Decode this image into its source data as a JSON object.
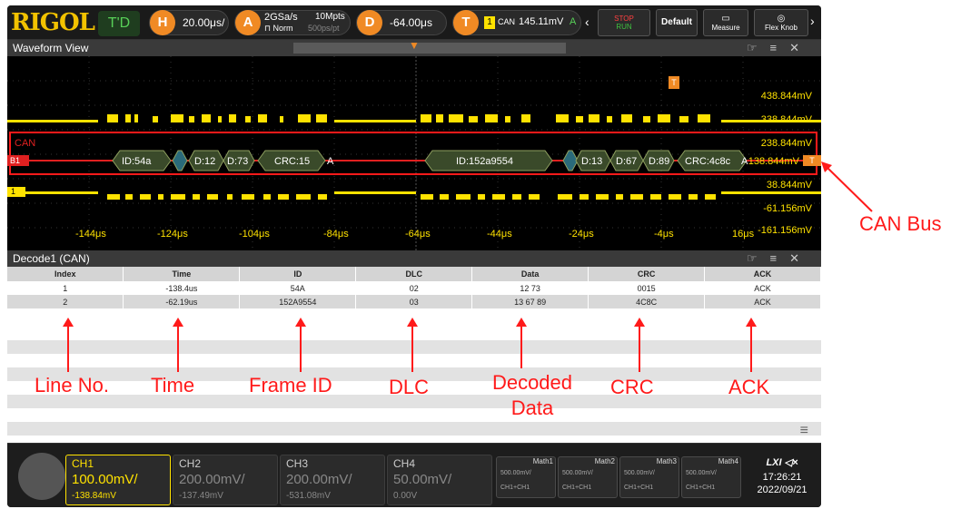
{
  "topbar": {
    "logo": "RIGOL",
    "trigger_mode": "T'D",
    "h_letter": "H",
    "timebase": "20.00μs/",
    "a_letter": "A",
    "sample_rate": "2GSa/s",
    "mem_depth": "10Mpts",
    "acq_mode": "Norm",
    "sample_interval": "500ps/pt",
    "d_letter": "D",
    "delay": "-64.00μs",
    "t_letter": "T",
    "trig_source_num": "1",
    "trig_type": "CAN",
    "trig_level": "145.11mV",
    "trig_sweep": "A",
    "stop": "STOP",
    "run": "RUN",
    "default": "Default",
    "measure": "Measure",
    "flex": "Flex Knob"
  },
  "waveform": {
    "title": "Waveform View",
    "bus_label": "CAN",
    "bus_marker": "B1",
    "ch1_marker": "1",
    "trig_marker": "T",
    "level_marker": "T",
    "decode": {
      "frame1": [
        "ID:54a",
        "D:12",
        "D:73",
        "CRC:15",
        "A"
      ],
      "frame2": [
        "ID:152a9554",
        "D:13",
        "D:67",
        "D:89",
        "CRC:4c8c",
        "A"
      ]
    },
    "voltage_labels": [
      "438.844mV",
      "338.844mV",
      "238.844mV",
      "138.844mV",
      "38.844mV",
      "-61.156mV",
      "-161.156mV"
    ],
    "time_labels": [
      "-144μs",
      "-124μs",
      "-104μs",
      "-84μs",
      "-64μs",
      "-44μs",
      "-24μs",
      "-4μs",
      "16μs"
    ]
  },
  "decode_panel": {
    "title": "Decode1 (CAN)",
    "columns": [
      "Index",
      "Time",
      "ID",
      "DLC",
      "Data",
      "CRC",
      "ACK"
    ],
    "rows": [
      [
        "1",
        "-138.4us",
        "54A",
        "02",
        "12 73",
        "0015",
        "ACK"
      ],
      [
        "2",
        "-62.19us",
        "152A9554",
        "03",
        "13 67 89",
        "4C8C",
        "ACK"
      ]
    ]
  },
  "channels": [
    {
      "name": "CH1",
      "scale": "100.00mV/",
      "offset": "-138.84mV"
    },
    {
      "name": "CH2",
      "scale": "200.00mV/",
      "offset": "-137.49mV"
    },
    {
      "name": "CH3",
      "scale": "200.00mV/",
      "offset": "-531.08mV"
    },
    {
      "name": "CH4",
      "scale": "50.00mV/",
      "offset": "0.00V"
    }
  ],
  "maths": [
    {
      "name": "Math1",
      "scale": "500.00mV/",
      "expr": "CH1+CH1"
    },
    {
      "name": "Math2",
      "scale": "500.00mV/",
      "expr": "CH1+CH1"
    },
    {
      "name": "Math3",
      "scale": "500.00mV/",
      "expr": "CH1+CH1"
    },
    {
      "name": "Math4",
      "scale": "500.00mV/",
      "expr": "CH1+CH1"
    }
  ],
  "status": {
    "lxi": "LXI",
    "time": "17:26:21",
    "date": "2022/09/21"
  },
  "annotations": {
    "can_bus": "CAN Bus",
    "line_no": "Line No.",
    "time": "Time",
    "frame_id": "Frame ID",
    "dlc": "DLC",
    "decoded_data": "Decoded Data",
    "crc": "CRC",
    "ack": "ACK"
  },
  "colors": {
    "ch1": "#ffe200",
    "bus": "#e02020",
    "accent": "#f08a24",
    "annotation": "#ff1a1a"
  }
}
